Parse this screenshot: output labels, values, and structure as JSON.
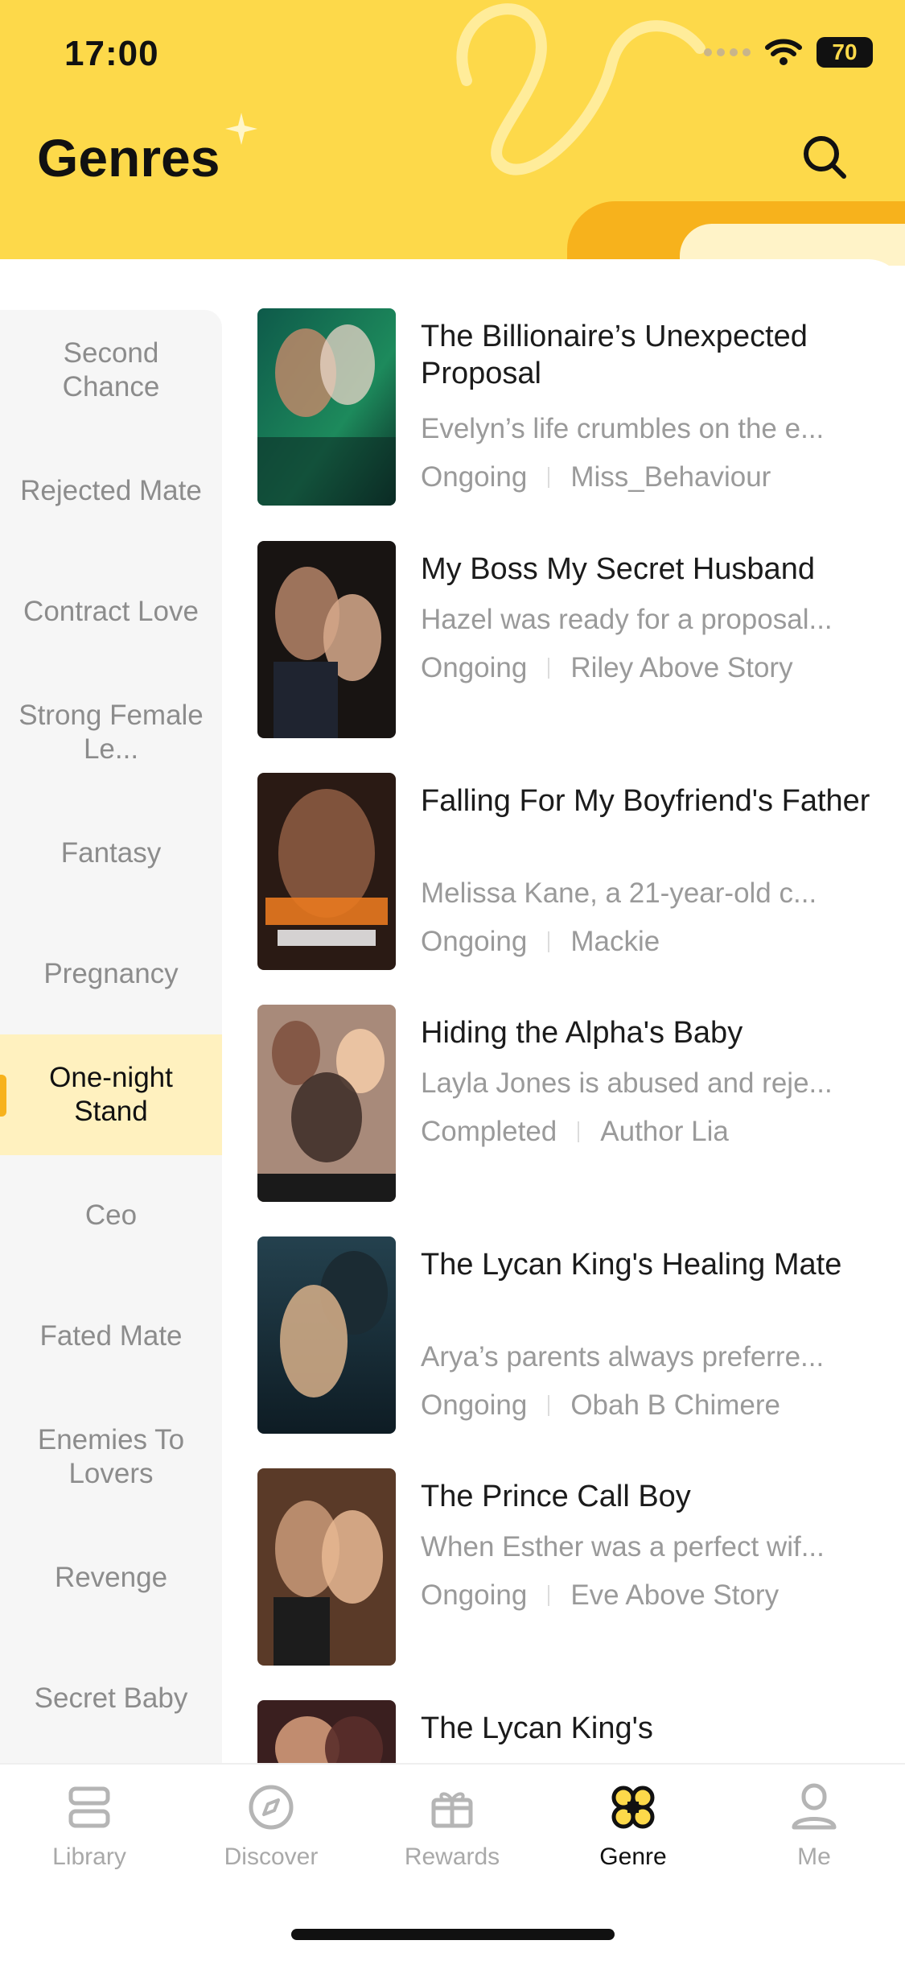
{
  "status_bar": {
    "time": "17:00",
    "battery": "70"
  },
  "header": {
    "title": "Genres"
  },
  "colors": {
    "accent": "#FDD94A",
    "accent_dark": "#F7B21C",
    "active_bg": "#FFF1BF"
  },
  "sidebar": {
    "items": [
      {
        "label": "Second Chance",
        "active": false
      },
      {
        "label": "Rejected Mate",
        "active": false
      },
      {
        "label": "Contract Love",
        "active": false
      },
      {
        "label": "Strong Female Le...",
        "active": false
      },
      {
        "label": "Fantasy",
        "active": false
      },
      {
        "label": "Pregnancy",
        "active": false
      },
      {
        "label": "One-night Stand",
        "active": true
      },
      {
        "label": "Ceo",
        "active": false
      },
      {
        "label": "Fated Mate",
        "active": false
      },
      {
        "label": "Enemies To Lovers",
        "active": false
      },
      {
        "label": "Revenge",
        "active": false
      },
      {
        "label": "Secret Baby",
        "active": false
      }
    ]
  },
  "books": [
    {
      "title": "The Billionaire’s Unexpected Proposal",
      "desc": "Evelyn’s life crumbles on the e...",
      "status": "Ongoing",
      "author": "Miss_Behaviour"
    },
    {
      "title": "My Boss My Secret Husband",
      "desc": "Hazel was ready for a proposal...",
      "status": "Ongoing",
      "author": "Riley Above Story"
    },
    {
      "title": "Falling For My Boyfriend's Father",
      "desc": "Melissa Kane,  a 21-year-old c...",
      "status": "Ongoing",
      "author": "Mackie"
    },
    {
      "title": "Hiding the Alpha's Baby",
      "desc": "Layla Jones is abused and reje...",
      "status": "Completed",
      "author": "Author Lia"
    },
    {
      "title": "The Lycan King's Healing Mate",
      "desc": "Arya’s parents always preferre...",
      "status": "Ongoing",
      "author": "Obah B Chimere"
    },
    {
      "title": "The Prince Call Boy",
      "desc": "When Esther was a perfect wif...",
      "status": "Ongoing",
      "author": "Eve Above Story"
    },
    {
      "title": "The Lycan King's",
      "desc": "",
      "status": "",
      "author": ""
    }
  ],
  "tabs": [
    {
      "label": "Library",
      "icon": "library-icon",
      "active": false
    },
    {
      "label": "Discover",
      "icon": "compass-icon",
      "active": false
    },
    {
      "label": "Rewards",
      "icon": "gift-icon",
      "active": false
    },
    {
      "label": "Genre",
      "icon": "clover-icon",
      "active": true
    },
    {
      "label": "Me",
      "icon": "person-icon",
      "active": false
    }
  ]
}
